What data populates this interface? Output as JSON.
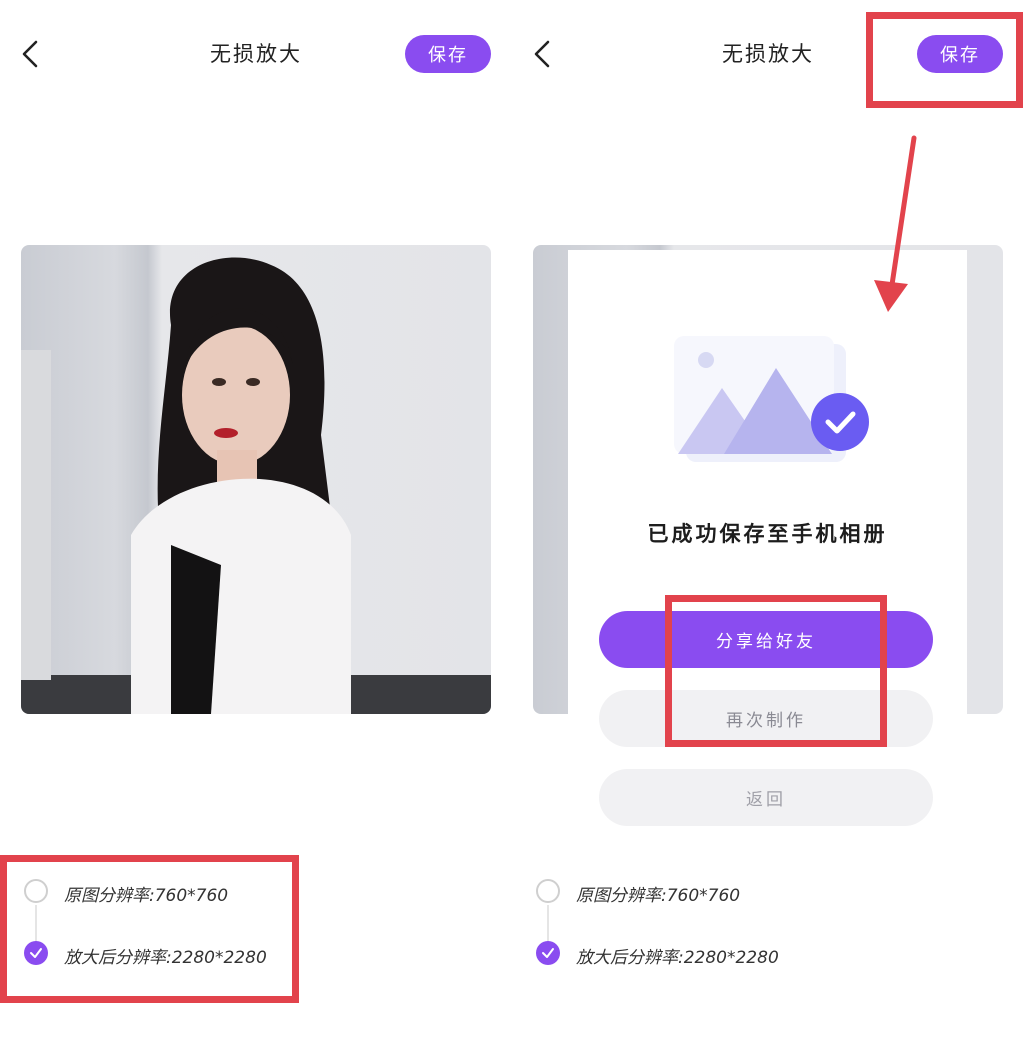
{
  "screens": {
    "left": {
      "title": "无损放大",
      "save_label": "保存",
      "resolutions": {
        "original": "原图分辨率:760*760",
        "upscaled": "放大后分辨率:2280*2280"
      }
    },
    "right": {
      "title": "无损放大",
      "save_label": "保存",
      "modal": {
        "message": "已成功保存至手机相册",
        "share_label": "分享给好友",
        "again_label": "再次制作",
        "return_label": "返回"
      },
      "resolutions": {
        "original": "原图分辨率:760*760",
        "upscaled": "放大后分辨率:2280*2280"
      }
    }
  },
  "colors": {
    "accent": "#8a4cf0",
    "annotation": "#e2434c"
  },
  "icons": [
    "back-chevron-icon",
    "check-icon",
    "image-saved-icon",
    "arrow-icon"
  ]
}
